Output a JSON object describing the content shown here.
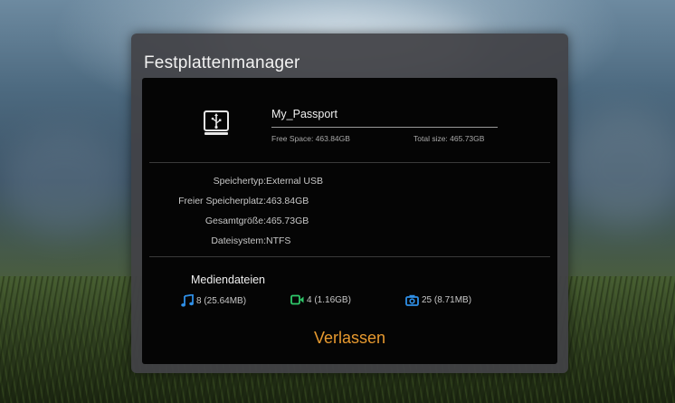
{
  "dialog": {
    "title": "Festplattenmanager"
  },
  "drive": {
    "name": "My_Passport",
    "free_space": "Free Space: 463.84GB",
    "total_size": "Total size: 465.73GB"
  },
  "details": [
    {
      "label": "Speichertyp:",
      "value": "External USB"
    },
    {
      "label": "Freier Speicherplatz:",
      "value": "463.84GB"
    },
    {
      "label": "Gesamtgröße:",
      "value": "465.73GB"
    },
    {
      "label": "Dateisystem:",
      "value": "NTFS"
    }
  ],
  "media": {
    "title": "Mediendateien",
    "music": {
      "icon": "music-note-icon",
      "text": "8 (25.64MB)",
      "color": "#2f8fe6"
    },
    "video": {
      "icon": "video-camera-icon",
      "text": "4 (1.16GB)",
      "color": "#2fc86a"
    },
    "photo": {
      "icon": "photo-camera-icon",
      "text": "25 (8.71MB)",
      "color": "#2f8fe6"
    }
  },
  "actions": {
    "exit_label": "Verlassen"
  },
  "colors": {
    "accent": "#e89a2f",
    "panel": "#050505",
    "dialog": "#424246"
  }
}
